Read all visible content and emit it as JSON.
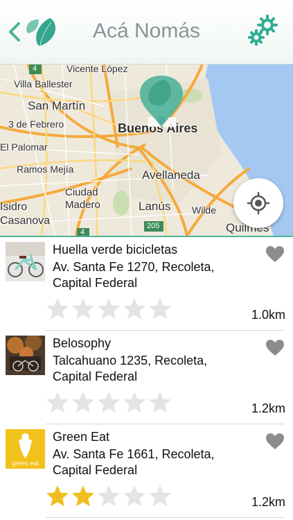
{
  "header": {
    "title": "Acá Nomás"
  },
  "map": {
    "labels": [
      {
        "text": "Vicente López"
      },
      {
        "text": "Villa Ballester"
      },
      {
        "text": "San Martín"
      },
      {
        "text": "3 de Febrero"
      },
      {
        "text": "El Palomar"
      },
      {
        "text": "Buenos Aires"
      },
      {
        "text": "Ramos Mejía"
      },
      {
        "text": "Avellaneda"
      },
      {
        "text": "Ciudad Madero"
      },
      {
        "text": "Lanús"
      },
      {
        "text": "Wilde"
      },
      {
        "text": "Isidro Casanova"
      },
      {
        "text": "Quilmes"
      }
    ],
    "routes": [
      "4",
      "205",
      "4"
    ]
  },
  "places": [
    {
      "name": "Huella verde bicicletas",
      "address": "Av. Santa Fe 1270, Recoleta, Capital Federal",
      "rating": 0,
      "max_rating": 5,
      "distance": "1.0km",
      "thumb": "bicycle-photo"
    },
    {
      "name": "Belosophy",
      "address": "Talcahuano 1235, Recoleta, Capital Federal",
      "rating": 0,
      "max_rating": 5,
      "distance": "1.2km",
      "thumb": "storefront-photo"
    },
    {
      "name": "Green Eat",
      "address": "Av. Santa Fe 1661, Recoleta, Capital Federal",
      "rating": 2,
      "max_rating": 5,
      "distance": "1.2km",
      "thumb": "green-eat-logo",
      "logo_text": "green eat"
    }
  ],
  "colors": {
    "accent": "#4fb39a",
    "star_on": "#f2be1f",
    "star_off": "#e4e4e4",
    "heart": "#8c8c8c"
  }
}
